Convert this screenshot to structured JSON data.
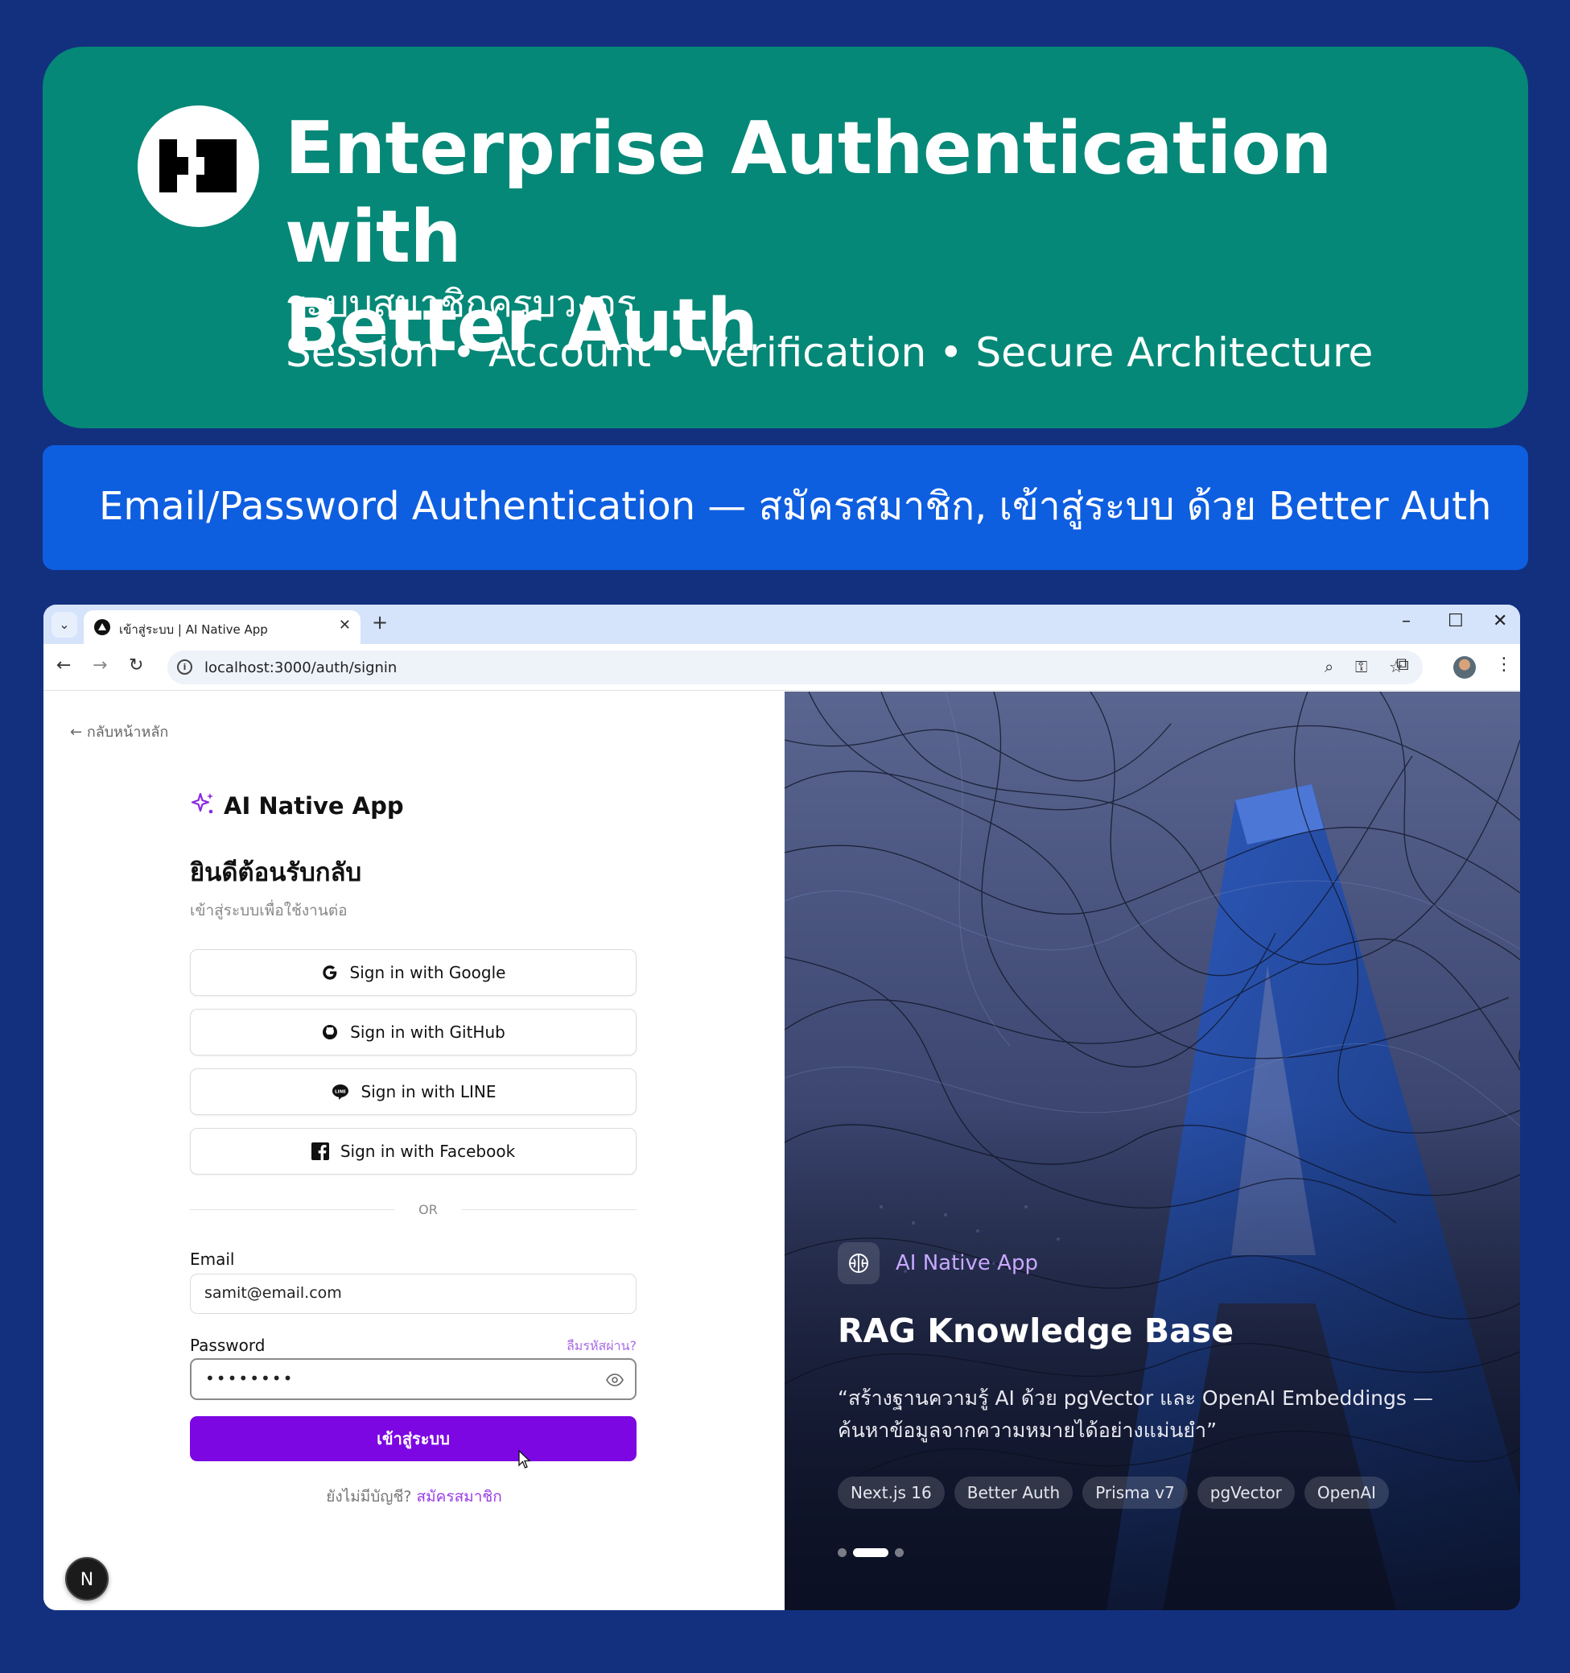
{
  "hero": {
    "title_line1": "Enterprise Authentication with",
    "title_line2": "Better Auth",
    "subtitle_thai": "ระบบสมาชิกครบวงจร",
    "subtitle_features": "Session • Account • Verification • Secure Architecture"
  },
  "stripe": {
    "text": "Email/Password Authentication — สมัครสมาชิก, เข้าสู่ระบบ ด้วย Better Auth"
  },
  "browser": {
    "tab_title": "เข้าสู่ระบบ | AI Native App",
    "url": "localhost:3000/auth/signin"
  },
  "signin": {
    "back_label": "กลับหน้าหลัก",
    "brand_name": "AI Native App",
    "welcome_title": "ยินดีต้อนรับกลับ",
    "welcome_subtitle": "เข้าสู่ระบบเพื่อใช้งานต่อ",
    "oauth_buttons": [
      {
        "label": "Sign in with Google",
        "icon": "google-icon"
      },
      {
        "label": "Sign in with GitHub",
        "icon": "github-icon"
      },
      {
        "label": "Sign in with LINE",
        "icon": "line-icon"
      },
      {
        "label": "Sign in with Facebook",
        "icon": "facebook-icon"
      }
    ],
    "divider_text": "OR",
    "email_label": "Email",
    "email_value": "samit@email.com",
    "password_label": "Password",
    "forgot_label": "ลืมรหัสผ่าน?",
    "password_value": "••••••••",
    "submit_label": "เข้าสู่ระบบ",
    "no_account_text": "ยังไม่มีบัญชี?",
    "signup_link": "สมัครสมาชิก",
    "next_badge": "N"
  },
  "showcase": {
    "badge_label": "AI Native App",
    "title": "RAG Knowledge Base",
    "quote": "“สร้างฐานความรู้ AI ด้วย pgVector และ OpenAI Embeddings — ค้นหาข้อมูลจากความหมายได้อย่างแม่นยำ”",
    "chips": [
      "Next.js 16",
      "Better Auth",
      "Prisma v7",
      "pgVector",
      "OpenAI"
    ],
    "carousel_count": 3,
    "carousel_active_index": 1
  },
  "colors": {
    "page_bg": "#13307f",
    "hero_bg": "#058877",
    "stripe_bg": "#0e5ee0",
    "primary_button": "#7c07e3",
    "accent_link": "#9b3de8"
  }
}
